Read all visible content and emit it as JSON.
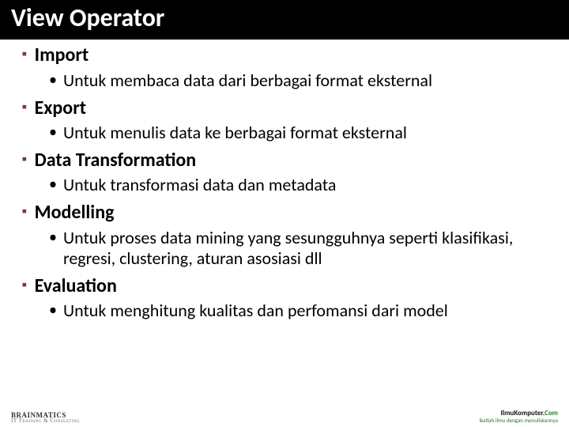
{
  "title": "View Operator",
  "sections": [
    {
      "heading": "Import",
      "sub": "Untuk membaca data dari berbagai format eksternal"
    },
    {
      "heading": "Export",
      "sub": "Untuk menulis data ke berbagai format eksternal"
    },
    {
      "heading": "Data Transformation",
      "sub": "Untuk transformasi data dan metadata"
    },
    {
      "heading": "Modelling",
      "sub": "Untuk proses data mining yang sesungguhnya seperti klasifikasi, regresi, clustering, aturan asosiasi dll"
    },
    {
      "heading": "Evaluation",
      "sub": "Untuk menghitung kualitas dan perfomansi dari model"
    }
  ],
  "footer": {
    "left_brand": "BRAINMATICS",
    "left_tag": "IT Training & Consulting",
    "right_brand_a": "IlmuKomputer.",
    "right_brand_b": "Com",
    "right_tag": "ikatlah ilmu dengan menuliskannya"
  }
}
